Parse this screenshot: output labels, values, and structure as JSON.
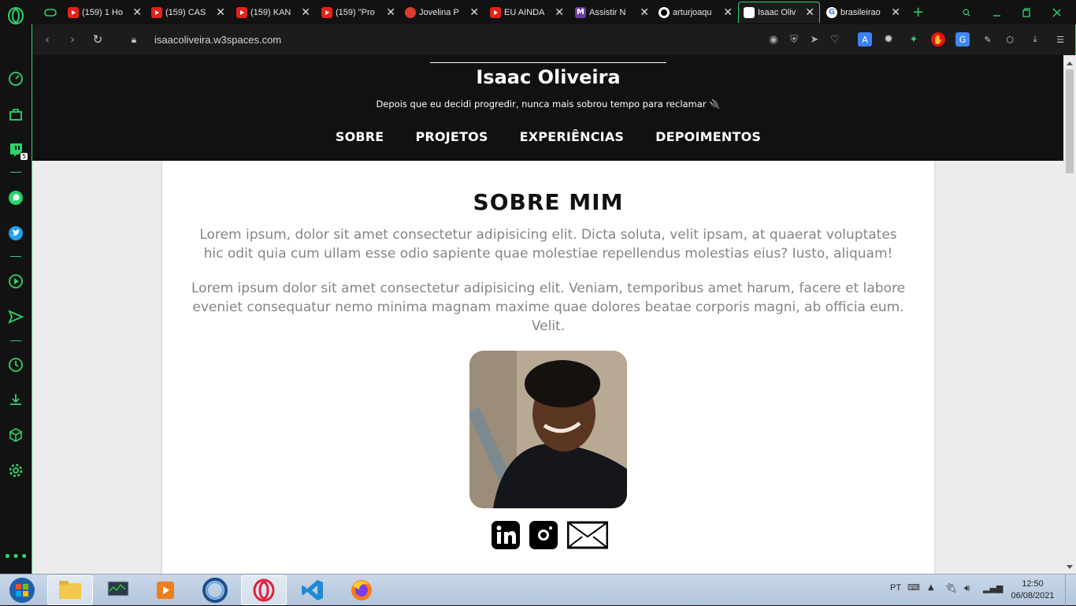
{
  "browser": {
    "tabs": [
      {
        "title": "(159) 1 Ho",
        "icon": "youtube-icon"
      },
      {
        "title": "(159) CAS",
        "icon": "youtube-icon"
      },
      {
        "title": "(159) KAN",
        "icon": "youtube-icon"
      },
      {
        "title": "(159) \"Pro",
        "icon": "youtube-icon"
      },
      {
        "title": "Jovelina P",
        "icon": "site-icon"
      },
      {
        "title": "EU AINDA",
        "icon": "youtube-icon"
      },
      {
        "title": "Assistir N",
        "icon": "m-logo-icon"
      },
      {
        "title": "arturjoaqu",
        "icon": "github-icon"
      },
      {
        "title": "Isaac Oliv",
        "icon": "page-icon",
        "active": true
      },
      {
        "title": "brasileirao",
        "icon": "google-icon"
      }
    ],
    "new_tab_label": "+",
    "url": "isaacoliveira.w3spaces.com",
    "accent_color": "#2fd36b",
    "sidebar_badge": "5"
  },
  "site": {
    "title": "Isaac Oliveira",
    "tagline": "Depois que eu decidi progredir, nunca mais sobrou tempo para reclamar 🔌",
    "nav": [
      "SOBRE",
      "PROJETOS",
      "EXPERIÊNCIAS",
      "DEPOIMENTOS"
    ],
    "about": {
      "heading": "SOBRE MIM",
      "paragraph1": "Lorem ipsum, dolor sit amet consectetur adipisicing elit. Dicta soluta, velit ipsam, at quaerat voluptates hic odit quia cum ullam esse odio sapiente quae molestiae repellendus molestias eius? Iusto, aliquam!",
      "paragraph2": "Lorem ipsum dolor sit amet consectetur adipisicing elit. Veniam, temporibus amet harum, facere et labore eveniet consequatur nemo minima magnam maxime quae dolores beatae corporis magni, ab officia eum. Velit."
    },
    "socials": [
      "linkedin-icon",
      "instagram-icon",
      "email-icon"
    ]
  },
  "taskbar": {
    "language": "PT",
    "time": "12:50",
    "date": "06/08/2021"
  }
}
